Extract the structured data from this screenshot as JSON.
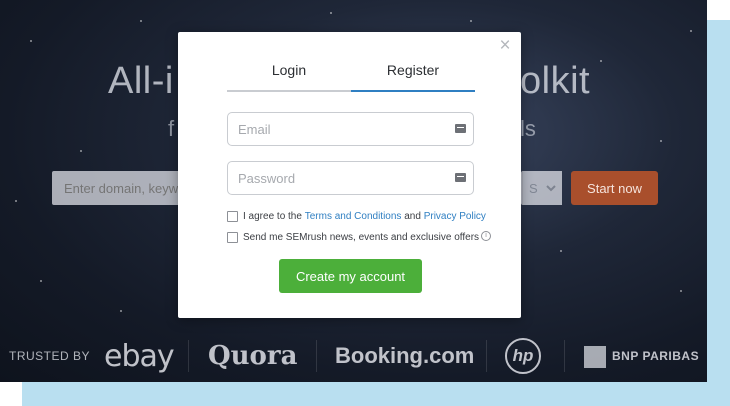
{
  "hero": {
    "title_left": "All-i",
    "title_right": "olkit",
    "subtitle_left": "f",
    "subtitle_right": "ls"
  },
  "search": {
    "placeholder": "Enter domain, keyw",
    "database_value": "S",
    "start_button": "Start now"
  },
  "trusted": {
    "label": "TRUSTED BY",
    "logos": [
      "ebay",
      "Quora",
      "Booking.com",
      "hp",
      "BNP PARIBAS"
    ]
  },
  "modal": {
    "close": "×",
    "tabs": [
      {
        "label": "Login",
        "active": false
      },
      {
        "label": "Register",
        "active": true
      }
    ],
    "email": {
      "placeholder": "Email",
      "value": ""
    },
    "password": {
      "placeholder": "Password",
      "value": ""
    },
    "agree": {
      "prefix": "I agree to the",
      "terms": "Terms and Conditions",
      "and": "and",
      "privacy": "Privacy Policy",
      "checked": false
    },
    "newsletter": {
      "label": "Send me SEMrush news, events and exclusive offers",
      "info": "i",
      "checked": false
    },
    "submit": "Create my account"
  },
  "colors": {
    "accent_backdrop": "#b9dff0",
    "tab_active": "#2f7fc2",
    "create_button": "#4caf3a",
    "start_button": "#a94f2c",
    "link": "#2f7fc2"
  }
}
